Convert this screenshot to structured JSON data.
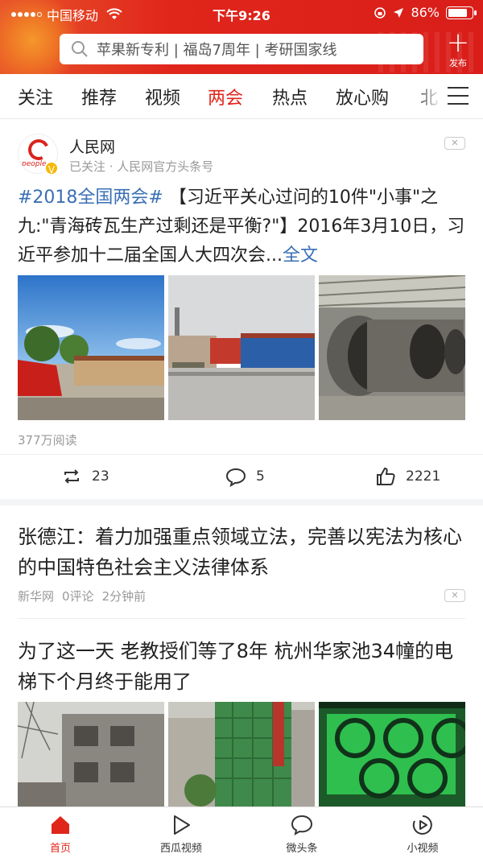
{
  "status_bar": {
    "carrier": "中国移动",
    "time": "下午9:26",
    "battery_percent_text": "86%",
    "battery_level": 0.86
  },
  "search": {
    "placeholder": "苹果新专利 | 福岛7周年 | 考研国家线"
  },
  "publish_label": "发布",
  "tabs": [
    {
      "label": "关注"
    },
    {
      "label": "推荐"
    },
    {
      "label": "视频"
    },
    {
      "label": "两会",
      "active": true
    },
    {
      "label": "热点"
    },
    {
      "label": "放心购"
    },
    {
      "label": "北"
    }
  ],
  "post": {
    "source": "人民网",
    "avatar_text": "people",
    "follow_info": "已关注 · 人民网官方头条号",
    "hashtag": "#2018全国两会#",
    "text": " 【习近平关心过问的10件\"小事\"之九:\"青海砖瓦生产过剩还是平衡?\"】2016年3月10日，习近平参加十二届全国人大四次会...",
    "full_text_link": "全文",
    "reads": "377万阅读",
    "reposts": "23",
    "comments": "5",
    "likes": "2221"
  },
  "articles": [
    {
      "title": "张德江：着力加强重点领域立法，完善以宪法为核心的中国特色社会主义法律体系",
      "source": "新华网",
      "comments": "0评论",
      "time": "2分钟前"
    },
    {
      "title": "为了这一天 老教授们等了8年 杭州华家池34幢的电梯下个月终于能用了"
    }
  ],
  "bottom_nav": [
    {
      "label": "首页",
      "icon": "home-icon",
      "active": true
    },
    {
      "label": "西瓜视频",
      "icon": "play-icon"
    },
    {
      "label": "微头条",
      "icon": "speech-bubble-icon"
    },
    {
      "label": "小视频",
      "icon": "small-video-icon"
    }
  ],
  "colors": {
    "brand_red": "#e0261b",
    "link_blue": "#3a6fb5"
  }
}
